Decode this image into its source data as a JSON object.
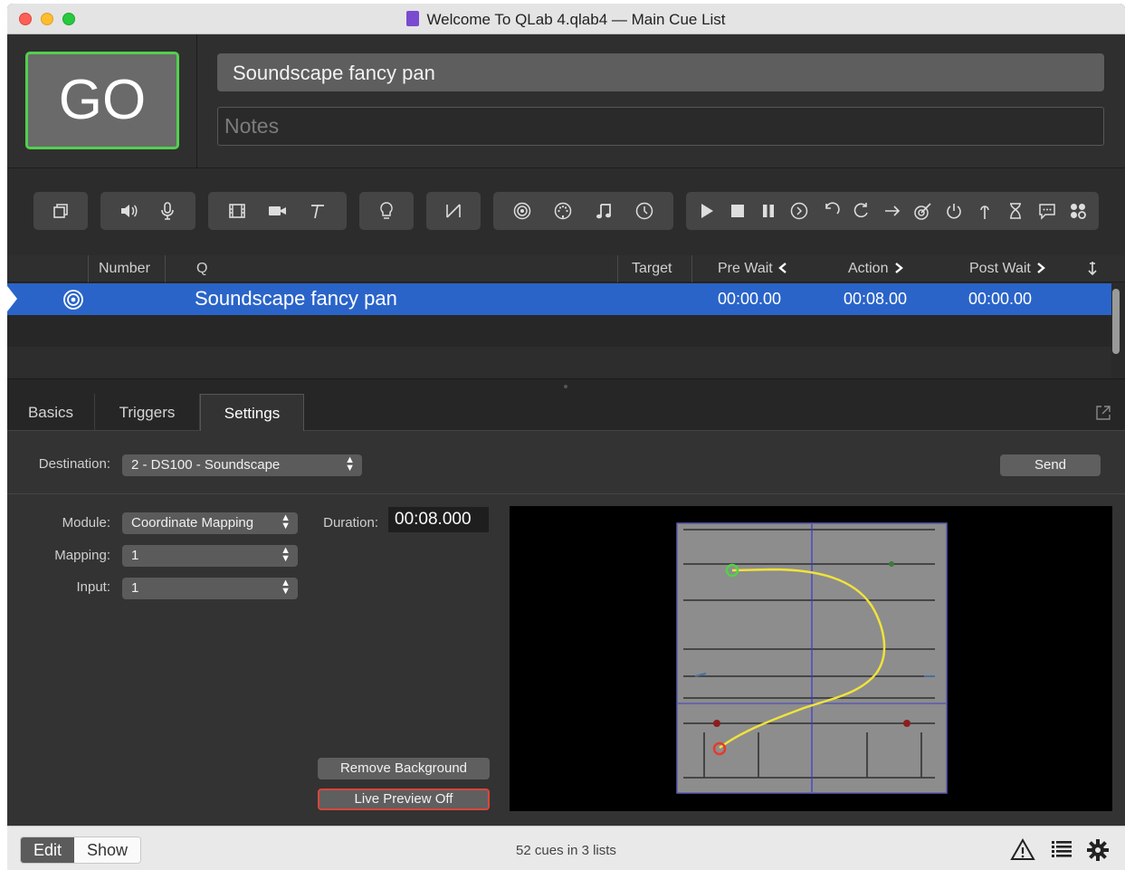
{
  "window": {
    "title": "Welcome To QLab 4.qlab4 — Main Cue List"
  },
  "go_button": {
    "label": "GO"
  },
  "cue_editor": {
    "name": "Soundscape fancy pan",
    "notes_placeholder": "Notes"
  },
  "toolbar": {
    "groups": [
      [
        "group-cue-icon"
      ],
      [
        "audio-icon",
        "mic-icon"
      ],
      [
        "video-icon",
        "camera-icon",
        "text-icon"
      ],
      [
        "light-icon"
      ],
      [
        "fade-icon"
      ],
      [
        "network-icon",
        "midi-icon",
        "music-icon",
        "timecode-icon"
      ],
      [
        "start-icon",
        "stop-icon",
        "pause-icon",
        "load-icon",
        "reset-icon",
        "devamp-icon",
        "goto-icon",
        "target-icon",
        "arm-icon",
        "disarm-icon",
        "wait-icon",
        "memo-icon",
        "script-icon"
      ]
    ]
  },
  "cue_list": {
    "columns": {
      "number": "Number",
      "q": "Q",
      "target": "Target",
      "pre_wait": "Pre Wait",
      "action": "Action",
      "post_wait": "Post Wait"
    },
    "rows": [
      {
        "number": "",
        "q": "Soundscape fancy pan",
        "target": "",
        "pre_wait": "00:00.00",
        "action": "00:08.00",
        "post_wait": "00:00.00",
        "selected": true,
        "icon": "network-cue-icon"
      }
    ]
  },
  "inspector": {
    "tabs": [
      "Basics",
      "Triggers",
      "Settings"
    ],
    "active_tab": "Settings",
    "destination_label": "Destination:",
    "destination_value": "2 - DS100 - Soundscape",
    "send_label": "Send",
    "module_label": "Module:",
    "module_value": "Coordinate Mapping",
    "mapping_label": "Mapping:",
    "mapping_value": "1",
    "input_label": "Input:",
    "input_value": "1",
    "duration_label": "Duration:",
    "duration_value": "00:08.000",
    "remove_background_label": "Remove Background",
    "live_preview_label": "Live Preview Off"
  },
  "footer": {
    "edit_label": "Edit",
    "show_label": "Show",
    "status": "52 cues in 3 lists"
  },
  "colors": {
    "go_border": "#53d04e",
    "selection": "#2a64c9",
    "path": "#f0e33a",
    "live_preview_border": "#d9463a"
  }
}
